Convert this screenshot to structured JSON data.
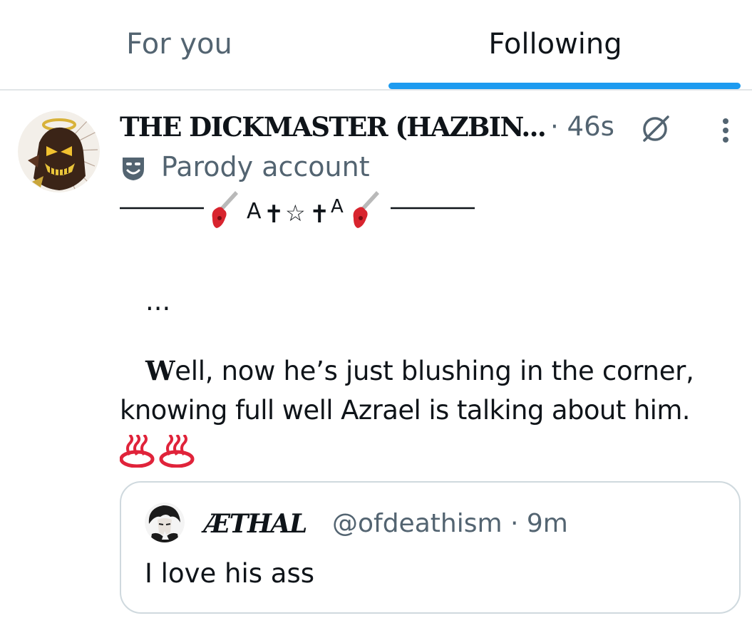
{
  "tabs": [
    {
      "label": "For you",
      "selected": false
    },
    {
      "label": "Following",
      "selected": true
    }
  ],
  "colors": {
    "accent": "#1d9bf0",
    "text_primary": "#0f1419",
    "text_secondary": "#536471",
    "border": "#cfd9de"
  },
  "post": {
    "display_name": "THE DICKMASTER (HAZBIN...",
    "time": "· 46s",
    "grok_icon": "grok-slash-icon",
    "more_icon": "vertical-dots-icon",
    "parody_icon": "theater-mask-icon",
    "parody_label": "Parody account",
    "decoration": "——— 🎸A✝☆✝A🎸 ———",
    "ellipsis": "...",
    "line1_initial": "W",
    "line1_rest": "ell, now he’s just blushing in the corner,",
    "line2": "knowing full well Azrael is talking about him.",
    "emoji": "♨♨"
  },
  "quote": {
    "display_name": "ÆTHAL",
    "handle_time": "@ofdeathism · 9m",
    "text": "I love his ass"
  }
}
